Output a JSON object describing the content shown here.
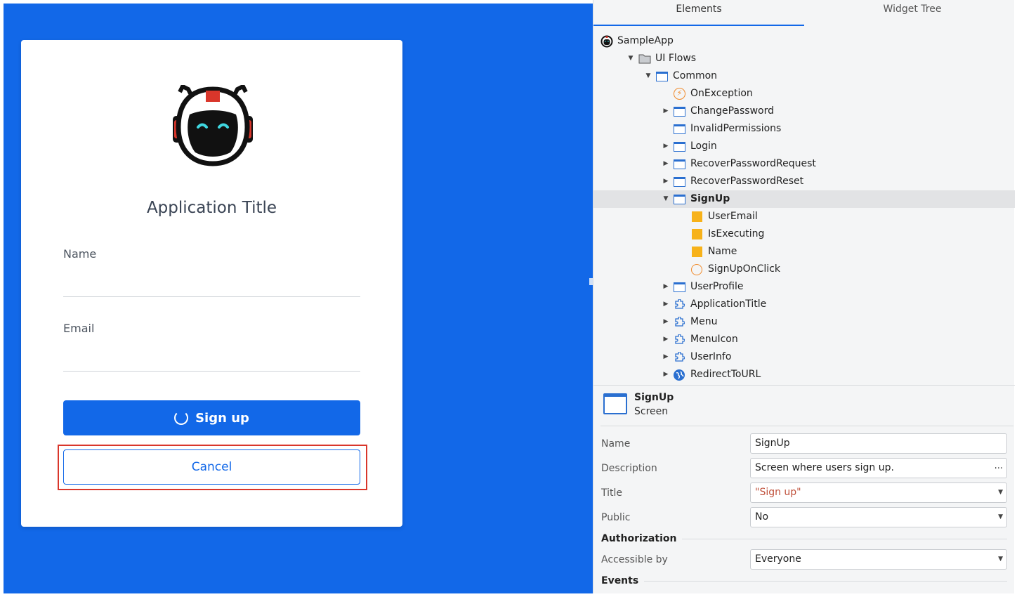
{
  "preview": {
    "app_title": "Application Title",
    "name_label": "Name",
    "email_label": "Email",
    "signup_label": "Sign up",
    "cancel_label": "Cancel"
  },
  "panel": {
    "tabs": [
      "Elements",
      "Widget Tree"
    ],
    "tree": [
      {
        "label": "SampleApp",
        "icon": "robot-icon",
        "level": 0,
        "arrow": "none"
      },
      {
        "label": "UI Flows",
        "icon": "folder-icon",
        "level": 1,
        "arrow": "down"
      },
      {
        "label": "Common",
        "icon": "screen-flow-icon",
        "level": 2,
        "arrow": "down"
      },
      {
        "label": "OnException",
        "icon": "exception-handler-icon",
        "level": 3,
        "arrow": "none"
      },
      {
        "label": "ChangePassword",
        "icon": "screen-icon",
        "level": 3,
        "arrow": "right"
      },
      {
        "label": "InvalidPermissions",
        "icon": "screen-icon",
        "level": 3,
        "arrow": "none"
      },
      {
        "label": "Login",
        "icon": "screen-icon",
        "level": 3,
        "arrow": "right"
      },
      {
        "label": "RecoverPasswordRequest",
        "icon": "screen-icon",
        "level": 3,
        "arrow": "right"
      },
      {
        "label": "RecoverPasswordReset",
        "icon": "screen-icon",
        "level": 3,
        "arrow": "right"
      },
      {
        "label": "SignUp",
        "icon": "screen-icon",
        "level": 3,
        "arrow": "down",
        "selected": true
      },
      {
        "label": "UserEmail",
        "icon": "variable-icon",
        "level": 4,
        "arrow": "none"
      },
      {
        "label": "IsExecuting",
        "icon": "variable-icon",
        "level": 4,
        "arrow": "none"
      },
      {
        "label": "Name",
        "icon": "variable-icon",
        "level": 4,
        "arrow": "none"
      },
      {
        "label": "SignUpOnClick",
        "icon": "screen-action-icon",
        "level": 4,
        "arrow": "none"
      },
      {
        "label": "UserProfile",
        "icon": "screen-icon",
        "level": 3,
        "arrow": "right"
      },
      {
        "label": "ApplicationTitle",
        "icon": "block-icon",
        "level": 3,
        "arrow": "right"
      },
      {
        "label": "Menu",
        "icon": "block-icon",
        "level": 3,
        "arrow": "right"
      },
      {
        "label": "MenuIcon",
        "icon": "block-icon",
        "level": 3,
        "arrow": "right"
      },
      {
        "label": "UserInfo",
        "icon": "block-icon",
        "level": 3,
        "arrow": "right"
      },
      {
        "label": "RedirectToURL",
        "icon": "globe-icon",
        "level": 3,
        "arrow": "right"
      }
    ],
    "properties": {
      "title": "SignUp",
      "subtitle": "Screen",
      "name_label": "Name",
      "name_value": "SignUp",
      "description_label": "Description",
      "description_value": "Screen where users sign up.",
      "description_more": "...",
      "title_label": "Title",
      "title_value": "\"Sign up\"",
      "public_label": "Public",
      "public_value": "No",
      "authorization_section": "Authorization",
      "accessible_by_label": "Accessible by",
      "accessible_by_value": "Everyone",
      "events_section": "Events"
    }
  },
  "colors": {
    "preview_background": "#1268e8",
    "primary": "#1268e8",
    "highlight_border": "#d9362b",
    "selected_row": "#e2e3e5"
  }
}
